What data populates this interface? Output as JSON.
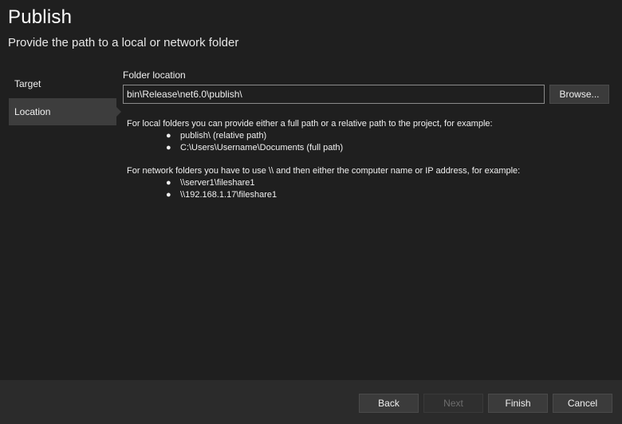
{
  "header": {
    "title": "Publish",
    "subtitle": "Provide the path to a local or network folder"
  },
  "nav": {
    "items": [
      {
        "label": "Target",
        "selected": false
      },
      {
        "label": "Location",
        "selected": true
      }
    ]
  },
  "main": {
    "field_label": "Folder location",
    "path_value": "bin\\Release\\net6.0\\publish\\",
    "browse_label": "Browse...",
    "local_help": {
      "intro": "For local folders you can provide either a full path or a relative path to the project, for example:",
      "examples": [
        "publish\\ (relative path)",
        "C:\\Users\\Username\\Documents (full path)"
      ]
    },
    "network_help": {
      "intro": "For network folders you have to use \\\\ and then either the computer name or IP address, for example:",
      "examples": [
        "\\\\server1\\fileshare1",
        "\\\\192.168.1.17\\fileshare1"
      ]
    },
    "bullet_glyph": "●"
  },
  "footer": {
    "back_label": "Back",
    "next_label": "Next",
    "finish_label": "Finish",
    "cancel_label": "Cancel"
  },
  "colors": {
    "background": "#1f1f1f",
    "footer_background": "#2b2b2b",
    "selected_nav": "#3d3d3d",
    "input_border": "#8a8a8a",
    "button_background": "#3b3b3b",
    "disabled_text": "#6e6e6e"
  }
}
